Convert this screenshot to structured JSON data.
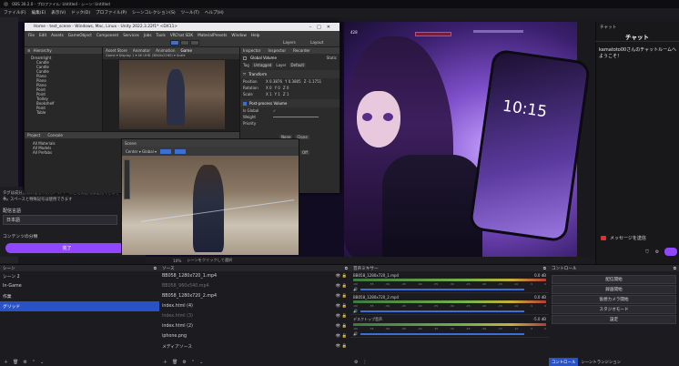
{
  "window": {
    "title": "OBS 30.2.0 - プロファイル: Untitled - シーン: Untitled"
  },
  "menubar": [
    "ファイル(F)",
    "編集(E)",
    "表示(V)",
    "ドック(D)",
    "プロファイル(P)",
    "シーンコレクション(S)",
    "ツール(T)",
    "ヘルプ(H)"
  ],
  "unity": {
    "title": "Home - test_scene - Windows, Mac, Linux - Unity 2022.3.22f1* <DX11>",
    "menu": [
      "File",
      "Edit",
      "Assets",
      "GameObject",
      "Component",
      "Services",
      "Jobs",
      "Tools",
      "VRChat SDK",
      "MaterialPresets",
      "Window",
      "Help"
    ],
    "panels": {
      "hierarchy": "Hierarchy",
      "asset_store": "Asset Store",
      "animator": "Animator",
      "animation": "Animation",
      "game": "Game",
      "inspector": "Inspector",
      "inspector2": "Inspector",
      "recorder": "Recorder"
    },
    "layers": "Layers",
    "layout": "Layout",
    "game_toolbar": "Game ▾  Display 1 ▾  4K UHD (3840x2160) ▾  Scale",
    "hierarchy_items": [
      "Dreamlight",
      "Candle",
      "Candle",
      "Candle",
      "Piano",
      "Piano",
      "Piano",
      "Point",
      "Point",
      "Trolley",
      "Bookshelf",
      "Point",
      "Table"
    ],
    "inspector": {
      "object": "Global Volume",
      "static": "Static",
      "tag_label": "Tag",
      "tag_value": "Untagged",
      "layer_label": "Layer",
      "layer_value": "Default",
      "transform": "Transform",
      "position_label": "Position",
      "position": [
        "X 0.3876",
        "Y 0.3805",
        "Z -1.1751"
      ],
      "rotation_label": "Rotation",
      "rotation": [
        "X 0",
        "Y 0",
        "Z 0"
      ],
      "scale_label": "Scale",
      "scale": [
        "X 1",
        "Y 1",
        "Z 1"
      ],
      "component": "Post-process Volume",
      "is_global": "Is Global",
      "weight": "Weight",
      "priority": "Priority",
      "none_btn": "None",
      "clone_btn": "Clone",
      "off_btn": "Off"
    },
    "project": {
      "tab_project": "Project",
      "tab_console": "Console",
      "favorites": [
        "All Materials",
        "All Models",
        "All Prefabs"
      ]
    },
    "scene": {
      "tab": "Scene",
      "toolbar": "Center ▾  Global ▾"
    }
  },
  "obs_left_panel": {
    "text": "タグは成分方法の値を入力し、スペースと特殊記号は使用できません。",
    "text2": "す。スペースと特殊記号は使用できます",
    "broadcast_label": "配信言語",
    "language": "日本語",
    "content_label": "コンテンツの分類",
    "done_button": "完了"
  },
  "preview": {
    "time": "10:15",
    "hud": "428"
  },
  "preview_bottom": {
    "zoom": "10%",
    "note": "シーンをクリックして選択"
  },
  "chat": {
    "dock_title": "チャット",
    "header": "チャット",
    "message": "kamatoto00さんのチャットルームへようこそ！",
    "send_button": "メッセージを送信"
  },
  "docks": {
    "scenes": {
      "title": "シーン",
      "items": [
        "シーン 2",
        "In-Game",
        "作業",
        "グリッド"
      ],
      "selected": 3
    },
    "sources": {
      "title": "ソース",
      "items": [
        {
          "name": "BB058_1280x720_1.mp4",
          "dim": false
        },
        {
          "name": "BB058_960x540.mp4",
          "dim": true
        },
        {
          "name": "BB058_1280x720_2.mp4",
          "dim": false
        },
        {
          "name": "index.html (4)",
          "dim": false
        },
        {
          "name": "index.html (3)",
          "dim": true
        },
        {
          "name": "index.html (2)",
          "dim": false
        },
        {
          "name": "iphone.png",
          "dim": false
        },
        {
          "name": "メディアソース",
          "dim": false
        }
      ]
    },
    "mixer": {
      "title": "音声ミキサー",
      "channels": [
        {
          "name": "BB058_1280x720_1.mp4",
          "db": "0.0 dB"
        },
        {
          "name": "BB058_1280x720_2.mp4",
          "db": "0.0 dB"
        },
        {
          "name": "デスクトップ音声",
          "db": "-5.0 dB"
        }
      ],
      "ticks": [
        "-60",
        "-55",
        "-50",
        "-45",
        "-40",
        "-35",
        "-30",
        "-25",
        "-20",
        "-15",
        "-10",
        "-5",
        "0"
      ]
    },
    "controls": {
      "title": "コントロール",
      "buttons": [
        "配信開始",
        "録画開始",
        "仮想カメラ開始",
        "スタジオモード",
        "設定"
      ],
      "tabs": [
        "コントロール",
        "シーントランジション"
      ]
    }
  },
  "colors": {
    "accent": "#2a52c7",
    "obs_purple": "#9147ff",
    "bg": "#1c1c20"
  }
}
